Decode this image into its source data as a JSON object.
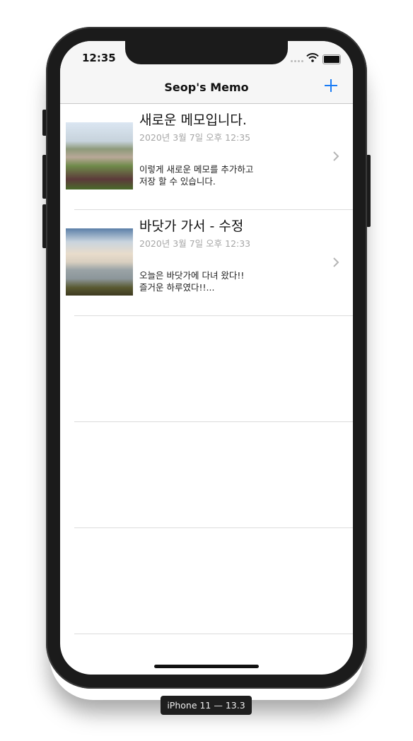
{
  "status_bar": {
    "time": "12:35"
  },
  "navbar": {
    "title": "Seop's Memo",
    "add_icon": "plus-icon"
  },
  "memos": [
    {
      "title": "새로운 메모입니다.",
      "date": "2020년 3월 7일 오후 12:35",
      "body_line1": "이렇게 새로운 메모를 추가하고",
      "body_line2": "저장 할 수 있습니다."
    },
    {
      "title": "바닷가 가서 - 수정",
      "date": "2020년 3월 7일 오후 12:33",
      "body_line1": "오늘은 바닷가에 다녀 왔다!!",
      "body_line2": "즐거운 하루였다!!..."
    }
  ],
  "device_label": "iPhone 11 — 13.3",
  "colors": {
    "accent": "#1a7cf5",
    "date_gray": "#a6a6a6"
  }
}
